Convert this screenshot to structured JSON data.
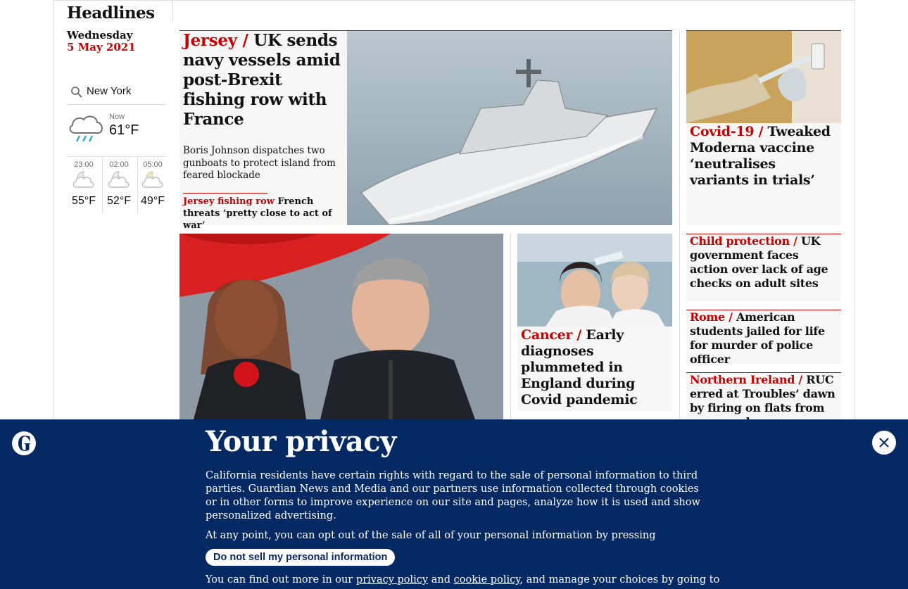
{
  "sidebar": {
    "title": "Headlines",
    "day": "Wednesday",
    "date": "5 May 2021",
    "search": {
      "icon": "search-icon",
      "city": "New York"
    },
    "weather_now": {
      "label": "Now",
      "temp": "61°F",
      "icon": "rain-cloud-icon"
    },
    "forecast": [
      {
        "time": "23:00",
        "temp": "55°F",
        "icon": "cloudy-night-icon"
      },
      {
        "time": "02:00",
        "temp": "52°F",
        "icon": "cloudy-night-icon"
      },
      {
        "time": "05:00",
        "temp": "49°F",
        "icon": "cloudy-night-icon"
      }
    ]
  },
  "lead": {
    "kicker": "Jersey /",
    "headline": " UK sends navy vessels amid post-Brexit fishing row with France",
    "standfirst": "Boris Johnson dispatches two gunboats to protect island from feared blockade",
    "sublink": {
      "kicker": "Jersey fishing row",
      "headline": " French threats ‘pretty close to act of war’"
    }
  },
  "side_top": {
    "kicker": "Covid-19 /",
    "headline": " Tweaked Moderna vaccine ‘neutralises variants in trials’"
  },
  "cancer": {
    "kicker": "Cancer /",
    "headline": " Early diagnoses plummeted in England during Covid pandemic"
  },
  "small_cards": [
    {
      "kicker": "Child protection /",
      "headline": " UK government faces action over lack of age checks on adult sites"
    },
    {
      "kicker": "Rome /",
      "headline": " American students jailed for life for murder of police officer"
    },
    {
      "kicker": "Northern Ireland /",
      "headline": " RUC erred at Troubles’ dawn by firing on flats from armoured cars"
    }
  ],
  "privacy": {
    "title": "Your privacy",
    "p1": "California residents have certain rights with regard to the sale of personal information to third parties. Guardian News and Media and our partners use information collected through cookies or in other forms to improve experience on our site and pages, analyze how it is used and show personalized advertising.",
    "p2": "At any point, you can opt out of the sale of all of your personal information by pressing",
    "button": "Do not sell my personal information",
    "p3_start": "You can find out more in our ",
    "privacy_link": "privacy policy",
    "and": " and ",
    "cookie_link": "cookie policy",
    "p3_end": ", and manage your choices by going to"
  },
  "colors": {
    "accent": "#c70000",
    "brand": "#052962",
    "card_bg": "#f6f6f6"
  }
}
